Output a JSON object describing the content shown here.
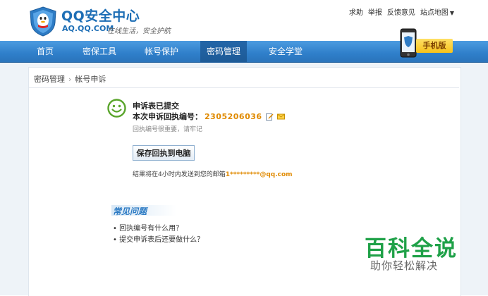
{
  "header": {
    "title": "QQ安全中心",
    "domain": "AQ.QQ.COM",
    "slogan": "在线生活，安全护航",
    "links": [
      "求助",
      "举报",
      "反馈意见",
      "站点地图"
    ]
  },
  "nav": {
    "items": [
      "首页",
      "密保工具",
      "帐号保护",
      "密码管理",
      "安全学堂"
    ],
    "active_index": 3,
    "promo_label": "手机版"
  },
  "breadcrumb": {
    "parent": "密码管理",
    "current": "帐号申诉"
  },
  "message": {
    "title": "申诉表已提交",
    "code_label": "本次申诉回执编号：",
    "code": "2305206036",
    "note": "回执编号很重要，请牢记"
  },
  "save_button": {
    "label": "保存回执到电脑"
  },
  "result": {
    "prefix": "结果将在4小时内发送到您的邮箱",
    "email": "1*********@qq.com"
  },
  "faq": {
    "title": "常见问题",
    "items": [
      "• 回执编号有什么用？",
      "• 提交申诉表后还要做什么？"
    ]
  },
  "watermark": {
    "main": "百科全说",
    "sub": "助你轻松解决"
  },
  "colors": {
    "brand_blue": "#1d6eb5",
    "nav_blue": "#2f7fca",
    "highlight_orange": "#e08a00",
    "watermark_green": "#1fa148"
  }
}
